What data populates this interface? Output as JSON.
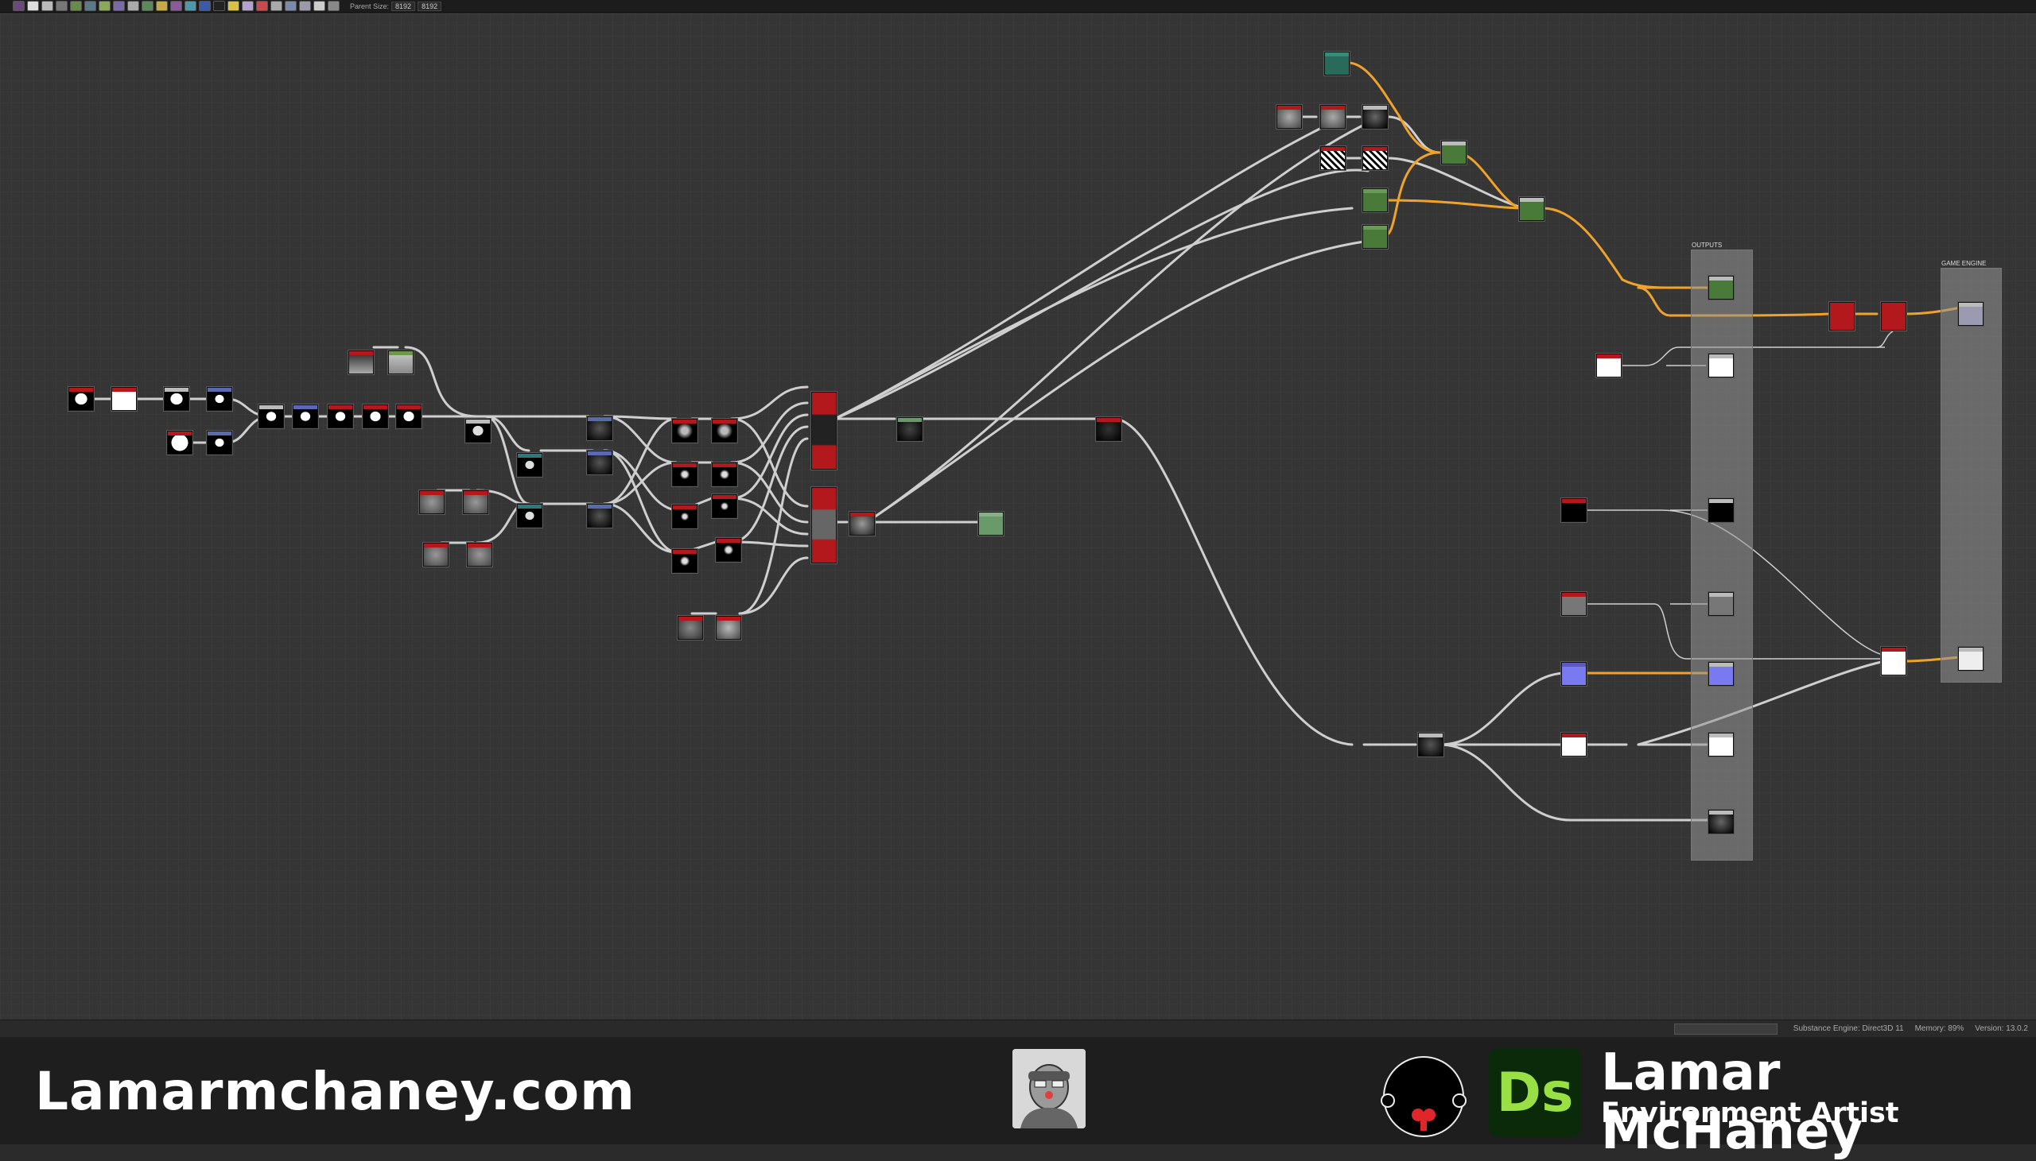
{
  "toolbar": {
    "parent_size_label": "Parent Size:",
    "parent_size_value": "8192",
    "output_size_value": "8192"
  },
  "frames": {
    "outputs_title": "OUTPUTS",
    "game_engine_title": "GAME ENGINE"
  },
  "status": {
    "engine": "Substance Engine: Direct3D 11",
    "memory": "Memory: 89%",
    "version": "Version: 13.0.2"
  },
  "footer": {
    "website": "Lamarmchaney.com",
    "name": "Lamar McHaney",
    "title": "Environment Artist",
    "app_badge": "Ds"
  },
  "colors": {
    "accent_orange": "#f0a32a",
    "link_white": "#cfcfcf",
    "node_red": "#b3181c",
    "node_green": "#4a7a3a",
    "ds_green": "#99e044"
  },
  "icons": [
    "avatar-icon",
    "monkey-logo-icon",
    "designer-logo-icon"
  ]
}
